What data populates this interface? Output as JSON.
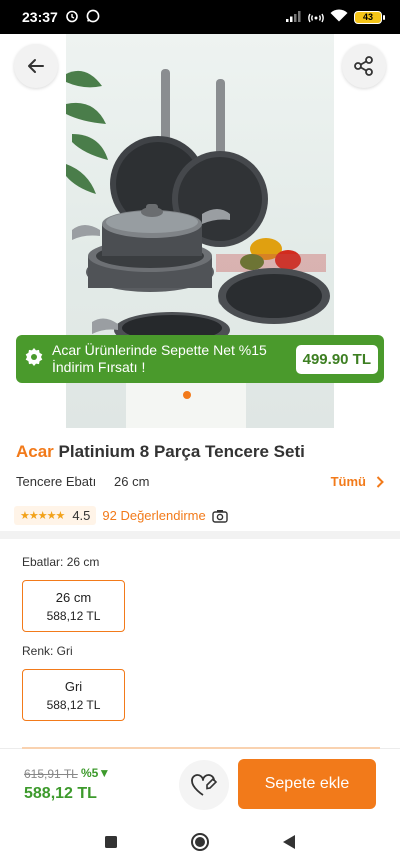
{
  "status_bar": {
    "time": "23:37",
    "battery": "43"
  },
  "promo": {
    "text": "Acar Ürünlerinde Sepette Net %15 İndirim Fırsatı !",
    "price": "499.90 TL"
  },
  "product": {
    "brand": "Acar",
    "name": "Platinium 8 Parça Tencere Seti",
    "size_label": "Tencere Ebatı",
    "size_value": "26 cm",
    "all_label": "Tümü",
    "rating": "4.5",
    "stars_shown": 4.5,
    "review_count": "92 Değerlendirme"
  },
  "variants": {
    "size_title": "Ebatlar: 26 cm",
    "size_option": {
      "name": "26 cm",
      "price": "588,12 TL"
    },
    "color_title": "Renk: Gri",
    "color_option": {
      "name": "Gri",
      "price": "588,12 TL"
    }
  },
  "bottom": {
    "old_price": "615,91 TL",
    "discount": "%5▼",
    "new_price": "588,12 TL",
    "add_to_cart": "Sepete ekle"
  },
  "colors": {
    "accent": "#f27a1a",
    "green": "#4a9a2c"
  }
}
